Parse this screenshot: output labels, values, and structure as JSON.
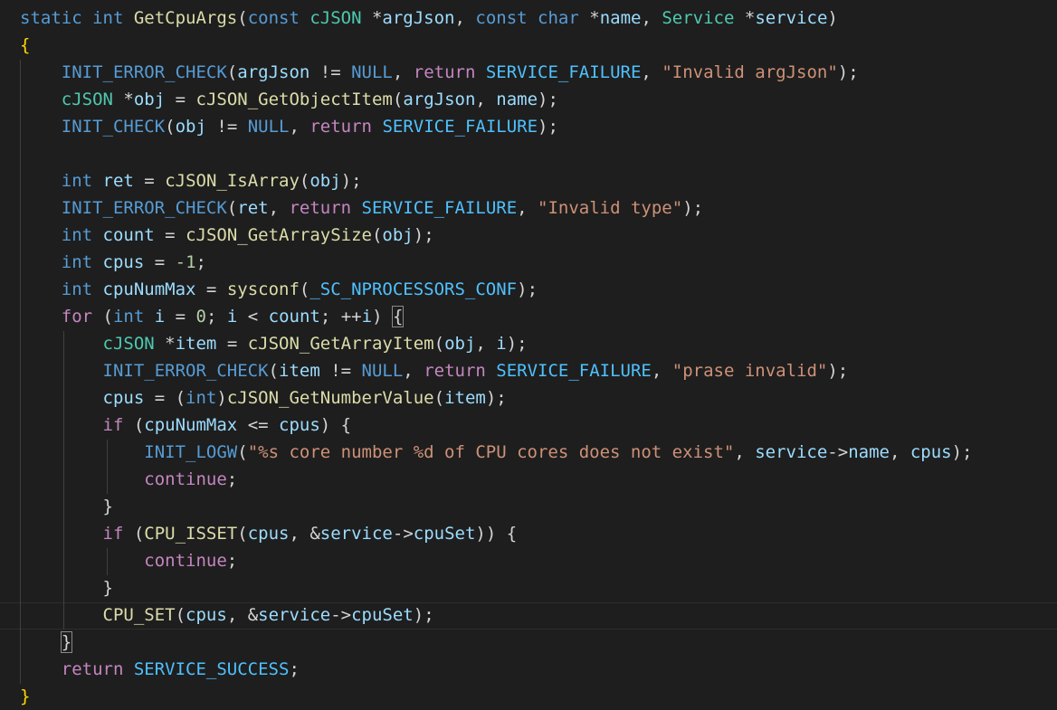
{
  "editor": {
    "lines": [
      [
        [
          "static int ",
          "k"
        ],
        [
          "GetCpuArgs",
          "f"
        ],
        [
          "(",
          ""
        ],
        [
          "const ",
          "k"
        ],
        [
          "cJSON ",
          "t"
        ],
        [
          "*",
          ""
        ],
        [
          "argJson",
          "v"
        ],
        [
          ", ",
          ""
        ],
        [
          "const char ",
          "k"
        ],
        [
          "*",
          ""
        ],
        [
          "name",
          "v"
        ],
        [
          ", ",
          ""
        ],
        [
          "Service ",
          "t"
        ],
        [
          "*",
          ""
        ],
        [
          "service",
          "v"
        ],
        [
          ")",
          ""
        ]
      ],
      [
        [
          "{",
          "b"
        ]
      ],
      [
        [
          "    ",
          ""
        ],
        [
          "INIT_ERROR_CHECK",
          "k"
        ],
        [
          "(",
          ""
        ],
        [
          "argJson",
          "v"
        ],
        [
          " != ",
          ""
        ],
        [
          "NULL",
          "k"
        ],
        [
          ", ",
          ""
        ],
        [
          "return ",
          "c"
        ],
        [
          "SERVICE_FAILURE",
          "m"
        ],
        [
          ", ",
          ""
        ],
        [
          "\"Invalid argJson\"",
          "s"
        ],
        [
          ");",
          ""
        ]
      ],
      [
        [
          "    ",
          ""
        ],
        [
          "cJSON ",
          "t"
        ],
        [
          "*",
          ""
        ],
        [
          "obj",
          "v"
        ],
        [
          " = ",
          ""
        ],
        [
          "cJSON_GetObjectItem",
          "f"
        ],
        [
          "(",
          ""
        ],
        [
          "argJson",
          "v"
        ],
        [
          ", ",
          ""
        ],
        [
          "name",
          "v"
        ],
        [
          ");",
          ""
        ]
      ],
      [
        [
          "    ",
          ""
        ],
        [
          "INIT_CHECK",
          "k"
        ],
        [
          "(",
          ""
        ],
        [
          "obj",
          "v"
        ],
        [
          " != ",
          ""
        ],
        [
          "NULL",
          "k"
        ],
        [
          ", ",
          ""
        ],
        [
          "return ",
          "c"
        ],
        [
          "SERVICE_FAILURE",
          "m"
        ],
        [
          ");",
          ""
        ]
      ],
      [],
      [
        [
          "    ",
          ""
        ],
        [
          "int ",
          "k"
        ],
        [
          "ret",
          "v"
        ],
        [
          " = ",
          ""
        ],
        [
          "cJSON_IsArray",
          "f"
        ],
        [
          "(",
          ""
        ],
        [
          "obj",
          "v"
        ],
        [
          ");",
          ""
        ]
      ],
      [
        [
          "    ",
          ""
        ],
        [
          "INIT_ERROR_CHECK",
          "k"
        ],
        [
          "(",
          ""
        ],
        [
          "ret",
          "v"
        ],
        [
          ", ",
          ""
        ],
        [
          "return ",
          "c"
        ],
        [
          "SERVICE_FAILURE",
          "m"
        ],
        [
          ", ",
          ""
        ],
        [
          "\"Invalid type\"",
          "s"
        ],
        [
          ");",
          ""
        ]
      ],
      [
        [
          "    ",
          ""
        ],
        [
          "int ",
          "k"
        ],
        [
          "count",
          "v"
        ],
        [
          " = ",
          ""
        ],
        [
          "cJSON_GetArraySize",
          "f"
        ],
        [
          "(",
          ""
        ],
        [
          "obj",
          "v"
        ],
        [
          ");",
          ""
        ]
      ],
      [
        [
          "    ",
          ""
        ],
        [
          "int ",
          "k"
        ],
        [
          "cpus",
          "v"
        ],
        [
          " = ",
          ""
        ],
        [
          "-1",
          "n"
        ],
        [
          ";",
          ""
        ]
      ],
      [
        [
          "    ",
          ""
        ],
        [
          "int ",
          "k"
        ],
        [
          "cpuNumMax",
          "v"
        ],
        [
          " = ",
          ""
        ],
        [
          "sysconf",
          "f"
        ],
        [
          "(",
          ""
        ],
        [
          "_SC_NPROCESSORS_CONF",
          "m"
        ],
        [
          ");",
          ""
        ]
      ],
      [
        [
          "    ",
          ""
        ],
        [
          "for ",
          "c"
        ],
        [
          "(",
          ""
        ],
        [
          "int ",
          "k"
        ],
        [
          "i",
          "v"
        ],
        [
          " = ",
          ""
        ],
        [
          "0",
          "n"
        ],
        [
          "; ",
          ""
        ],
        [
          "i",
          "v"
        ],
        [
          " < ",
          ""
        ],
        [
          "count",
          "v"
        ],
        [
          "; ++",
          ""
        ],
        [
          "i",
          "v"
        ],
        [
          ") ",
          ""
        ],
        [
          "{",
          "bm"
        ]
      ],
      [
        [
          "        ",
          ""
        ],
        [
          "cJSON ",
          "t"
        ],
        [
          "*",
          ""
        ],
        [
          "item",
          "v"
        ],
        [
          " = ",
          ""
        ],
        [
          "cJSON_GetArrayItem",
          "f"
        ],
        [
          "(",
          ""
        ],
        [
          "obj",
          "v"
        ],
        [
          ", ",
          ""
        ],
        [
          "i",
          "v"
        ],
        [
          ");",
          ""
        ]
      ],
      [
        [
          "        ",
          ""
        ],
        [
          "INIT_ERROR_CHECK",
          "k"
        ],
        [
          "(",
          ""
        ],
        [
          "item",
          "v"
        ],
        [
          " != ",
          ""
        ],
        [
          "NULL",
          "k"
        ],
        [
          ", ",
          ""
        ],
        [
          "return ",
          "c"
        ],
        [
          "SERVICE_FAILURE",
          "m"
        ],
        [
          ", ",
          ""
        ],
        [
          "\"prase invalid\"",
          "s"
        ],
        [
          ");",
          ""
        ]
      ],
      [
        [
          "        ",
          ""
        ],
        [
          "cpus",
          "v"
        ],
        [
          " = (",
          ""
        ],
        [
          "int",
          "k"
        ],
        [
          ")",
          ""
        ],
        [
          "cJSON_GetNumberValue",
          "f"
        ],
        [
          "(",
          ""
        ],
        [
          "item",
          "v"
        ],
        [
          ");",
          ""
        ]
      ],
      [
        [
          "        ",
          ""
        ],
        [
          "if ",
          "c"
        ],
        [
          "(",
          ""
        ],
        [
          "cpuNumMax",
          "v"
        ],
        [
          " <= ",
          ""
        ],
        [
          "cpus",
          "v"
        ],
        [
          ") {",
          ""
        ]
      ],
      [
        [
          "            ",
          ""
        ],
        [
          "INIT_LOGW",
          "k"
        ],
        [
          "(",
          ""
        ],
        [
          "\"%s core number %d of CPU cores does not exist\"",
          "s"
        ],
        [
          ", ",
          ""
        ],
        [
          "service",
          "v"
        ],
        [
          "->",
          ""
        ],
        [
          "name",
          "v"
        ],
        [
          ", ",
          ""
        ],
        [
          "cpus",
          "v"
        ],
        [
          ");",
          ""
        ]
      ],
      [
        [
          "            ",
          ""
        ],
        [
          "continue",
          "c"
        ],
        [
          ";",
          ""
        ]
      ],
      [
        [
          "        ",
          ""
        ],
        [
          "}",
          ""
        ]
      ],
      [
        [
          "        ",
          ""
        ],
        [
          "if ",
          "c"
        ],
        [
          "(",
          ""
        ],
        [
          "CPU_ISSET",
          "f"
        ],
        [
          "(",
          ""
        ],
        [
          "cpus",
          "v"
        ],
        [
          ", &",
          ""
        ],
        [
          "service",
          "v"
        ],
        [
          "->",
          ""
        ],
        [
          "cpuSet",
          "v"
        ],
        [
          ")) {",
          ""
        ]
      ],
      [
        [
          "            ",
          ""
        ],
        [
          "continue",
          "c"
        ],
        [
          ";",
          ""
        ]
      ],
      [
        [
          "        ",
          ""
        ],
        [
          "}",
          ""
        ]
      ],
      [
        [
          "        ",
          ""
        ],
        [
          "CPU_SET",
          "f"
        ],
        [
          "(",
          ""
        ],
        [
          "cpus",
          "v"
        ],
        [
          ", &",
          ""
        ],
        [
          "service",
          "v"
        ],
        [
          "->",
          ""
        ],
        [
          "cpuSet",
          "v"
        ],
        [
          ");",
          ""
        ]
      ],
      [
        [
          "    ",
          ""
        ],
        [
          "}",
          "bm"
        ]
      ],
      [
        [
          "    ",
          ""
        ],
        [
          "return ",
          "c"
        ],
        [
          "SERVICE_SUCCESS",
          "m"
        ],
        [
          ";",
          ""
        ]
      ],
      [
        [
          "}",
          "b"
        ]
      ]
    ]
  }
}
